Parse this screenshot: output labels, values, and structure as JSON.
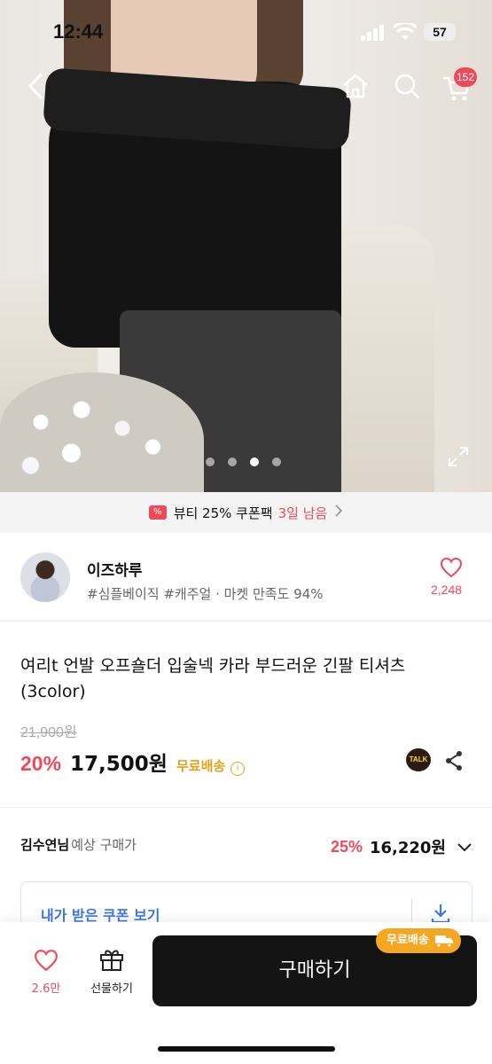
{
  "status_bar": {
    "time": "12:44",
    "battery": "57"
  },
  "nav": {
    "cart_count": "152"
  },
  "carousel": {
    "pages": 4,
    "active_index": 2
  },
  "coupon_banner": {
    "text": "뷰티 25% 쿠폰팩",
    "highlight": "3일 남음"
  },
  "shop": {
    "name": "이즈하루",
    "tags": "#심플베이직 #캐주얼 · 마켓 만족도 94%",
    "likes": "2,248"
  },
  "product": {
    "title": "여리t 언발 오프숄더 입술넥 카라 부드러운 긴팔 티셔츠 (3color)",
    "original_price": "21,900원",
    "discount": "20%",
    "price": "17,500원",
    "shipping": "무료배송",
    "talk_label": "TALK"
  },
  "expected_price": {
    "user": "김수연님",
    "label": "예상 구매가",
    "discount": "25%",
    "price": "16,220원"
  },
  "coupon_box": {
    "text": "내가 받은 쿠폰 보기"
  },
  "bottom_bar": {
    "like_count": "2.6만",
    "gift_label": "선물하기",
    "buy_label": "구매하기",
    "shipping_pill": "무료배송"
  },
  "colors": {
    "accent": "#ef4a5a",
    "shipping": "#e3a21b",
    "link": "#3b78e6",
    "buy_bg": "#141414"
  }
}
